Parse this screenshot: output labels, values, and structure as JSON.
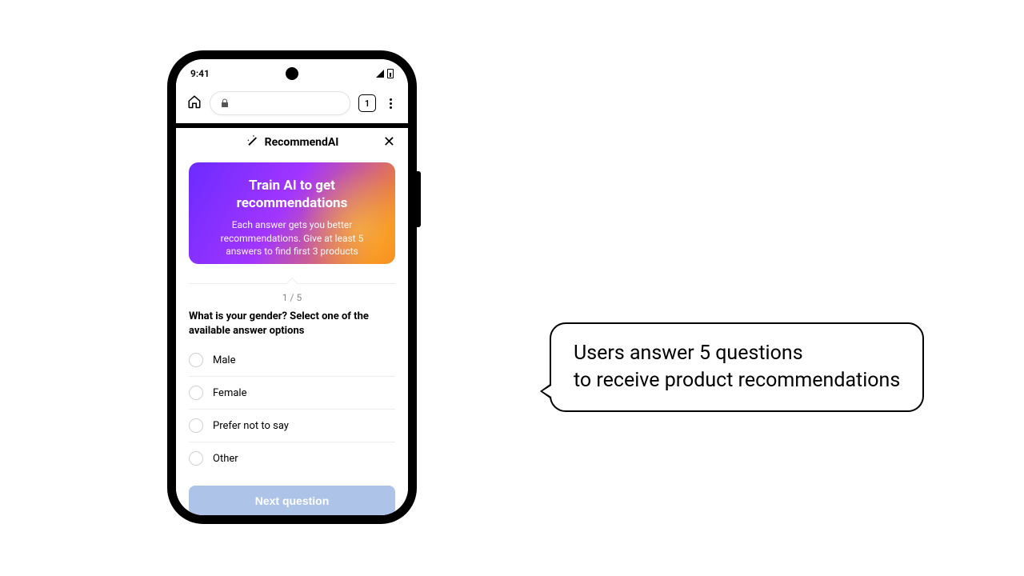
{
  "status": {
    "time": "9:41"
  },
  "browser": {
    "tab_count": "1"
  },
  "app": {
    "title": "RecommendAI",
    "hero_title": "Train AI to get recommendations",
    "hero_body": "Each answer gets you better recommendations. Give at least 5 answers to find first 3 products",
    "progress": "1 / 5",
    "question": "What is your gender? Select one of the available answer options",
    "options": [
      "Male",
      "Female",
      "Prefer not to say",
      "Other"
    ],
    "next_label": "Next question"
  },
  "callout": {
    "line1": "Users answer 5 questions",
    "line2": "to receive product recommendations"
  }
}
